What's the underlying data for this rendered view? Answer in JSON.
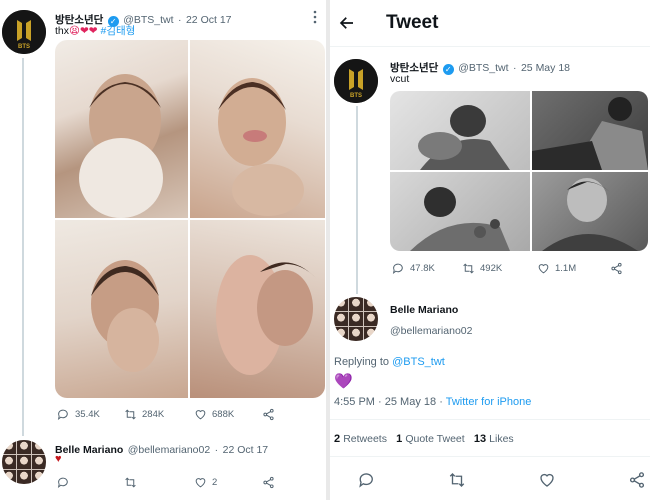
{
  "left": {
    "tweet": {
      "author_name": "방탄소년단",
      "handle": "@BTS_twt",
      "separator": "·",
      "date": "22 Oct 17",
      "text": "thx",
      "emojis": "😫❤❤",
      "hashtag": "#김태형",
      "actions": {
        "replies": "35.4K",
        "retweets": "284K",
        "likes": "688K"
      }
    },
    "reply": {
      "author_name": "Belle Mariano",
      "handle": "@bellemariano02",
      "separator": "·",
      "date": "22 Oct 17",
      "text": "♥",
      "actions": {
        "likes": "2"
      }
    }
  },
  "right": {
    "header": {
      "title": "Tweet"
    },
    "quoted": {
      "author_name": "방탄소년단",
      "handle": "@BTS_twt",
      "separator": "·",
      "date": "25 May 18",
      "text": "vcut",
      "actions": {
        "replies": "47.8K",
        "retweets": "492K",
        "likes": "1.1M"
      }
    },
    "main": {
      "author_name": "Belle Mariano",
      "handle": "@bellemariano02",
      "replying_prefix": "Replying to",
      "replying_to": "@BTS_twt",
      "heart": "💜",
      "time": "4:55 PM",
      "separator": "·",
      "date": "25 May 18",
      "separator2": "·",
      "source": "Twitter for iPhone"
    },
    "stats": {
      "retweets_count": "2",
      "retweets_label": "Retweets",
      "quotes_count": "1",
      "quotes_label": "Quote Tweet",
      "likes_count": "13",
      "likes_label": "Likes"
    }
  },
  "brand": {
    "logo_text": "BTS",
    "logo_color": "#c9a227"
  },
  "colors": {
    "accent": "#1d9bf0",
    "secondary": "#536471",
    "line": "#cfd9de",
    "heart": "#e0245e"
  },
  "icons": [
    "verified-badge-icon",
    "reply-icon",
    "retweet-icon",
    "like-icon",
    "share-icon",
    "back-arrow-icon",
    "more-vertical-icon"
  ]
}
